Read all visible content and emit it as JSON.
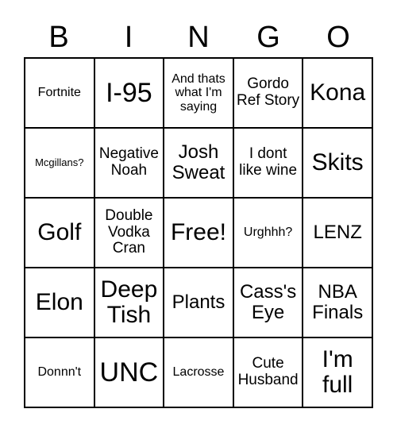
{
  "card": {
    "header_letters": [
      "B",
      "I",
      "N",
      "G",
      "O"
    ],
    "columns": [
      {
        "letter": "B",
        "cells": [
          {
            "text": "Fortnite",
            "size": "sm"
          },
          {
            "text": "Mcgillans?",
            "size": "xs"
          },
          {
            "text": "Golf",
            "size": "xl"
          },
          {
            "text": "Elon",
            "size": "xl"
          },
          {
            "text": "Donnn't",
            "size": "sm"
          }
        ]
      },
      {
        "letter": "I",
        "cells": [
          {
            "text": "I-95",
            "size": "xxl"
          },
          {
            "text": "Negative Noah",
            "size": "md"
          },
          {
            "text": "Double Vodka Cran",
            "size": "md"
          },
          {
            "text": "Deep Tish",
            "size": "xl"
          },
          {
            "text": "UNC",
            "size": "xxl"
          }
        ]
      },
      {
        "letter": "N",
        "cells": [
          {
            "text": "And thats what I'm saying",
            "size": "sm"
          },
          {
            "text": "Josh Sweat",
            "size": "lg"
          },
          {
            "text": "Free!",
            "size": "xl"
          },
          {
            "text": "Plants",
            "size": "lg"
          },
          {
            "text": "Lacrosse",
            "size": "sm"
          }
        ]
      },
      {
        "letter": "G",
        "cells": [
          {
            "text": "Gordo Ref Story",
            "size": "md"
          },
          {
            "text": "I dont like wine",
            "size": "md"
          },
          {
            "text": "Urghhh?",
            "size": "sm"
          },
          {
            "text": "Cass's Eye",
            "size": "lg"
          },
          {
            "text": "Cute Husband",
            "size": "md"
          }
        ]
      },
      {
        "letter": "O",
        "cells": [
          {
            "text": "Kona",
            "size": "xl"
          },
          {
            "text": "Skits",
            "size": "xl"
          },
          {
            "text": "LENZ",
            "size": "lg"
          },
          {
            "text": "NBA Finals",
            "size": "lg"
          },
          {
            "text": "I'm full",
            "size": "xl"
          }
        ]
      }
    ],
    "free_space": {
      "label": "Free!",
      "row": 2,
      "column": 2
    },
    "colors": {
      "background": "#ffffff",
      "grid_line": "#000000",
      "text": "#000000"
    }
  }
}
